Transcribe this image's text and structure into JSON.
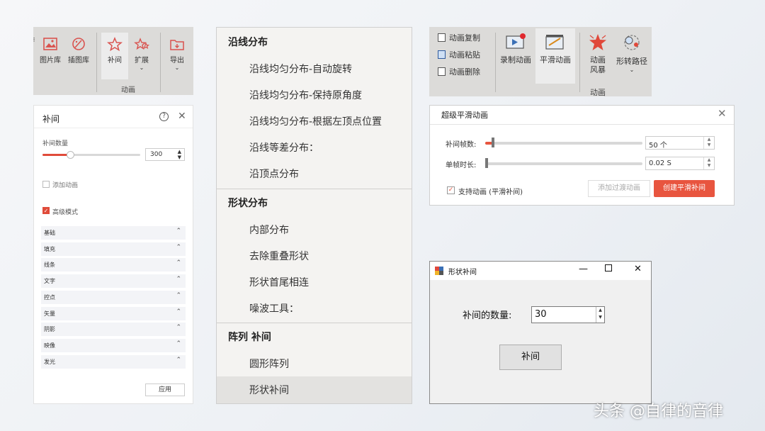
{
  "ribbon_tools": {
    "buttons": [
      "图片库",
      "插图库",
      "补间",
      "扩展",
      "导出"
    ],
    "group_label": "动画"
  },
  "tween_panel": {
    "title": "补间",
    "help_icon": "question-circle-icon",
    "count_label": "补间数量",
    "count_value": "300",
    "count_fraction": 0.28,
    "add_anim_label": "添加动画",
    "add_anim_checked": false,
    "advanced_label": "高级模式",
    "advanced_checked": true,
    "sections": [
      "基础",
      "填充",
      "线条",
      "文字",
      "控点",
      "矢量",
      "阴影",
      "映像",
      "发光"
    ],
    "apply_label": "应用",
    "accent": "#e04b3a"
  },
  "menu": {
    "sec1_head": "沿线分布",
    "sec1_items": [
      "沿线均匀分布-自动旋转",
      "沿线均匀分布-保持原角度",
      "沿线均匀分布-根据左顶点位置",
      "沿线等差分布：",
      "沿顶点分布"
    ],
    "sec2_head": "形状分布",
    "sec2_items": [
      "内部分布",
      "去除重叠形状",
      "形状首尾相连",
      "噪波工具："
    ],
    "sec3_head": "阵列 补间",
    "sec3_items": [
      "圆形阵列",
      "形状补间"
    ],
    "selected_item": "形状补间"
  },
  "ribbon_anim": {
    "small_buttons": [
      "动画复制",
      "动画粘贴",
      "动画删除"
    ],
    "large_buttons": [
      "录制动画",
      "平滑动画",
      "动画\n风暴",
      "形转路径"
    ],
    "group_label": "动画"
  },
  "smooth_dialog": {
    "title": "超级平滑动画",
    "frames_label": "补间帧数:",
    "frames_value": "50 个",
    "frame_time_label": "单帧时长:",
    "frame_time_value": "0.02 S",
    "support_label": "支持动画 (平滑补间)",
    "support_checked": true,
    "add_transition_label": "添加过渡动画",
    "create_label": "创建平滑补间",
    "accent": "#e8553f"
  },
  "shape_tween_form": {
    "title": "形状补间",
    "count_label": "补间的数量:",
    "count_value": "30",
    "button_label": "补间"
  },
  "watermark": "头条 @自律的音律"
}
